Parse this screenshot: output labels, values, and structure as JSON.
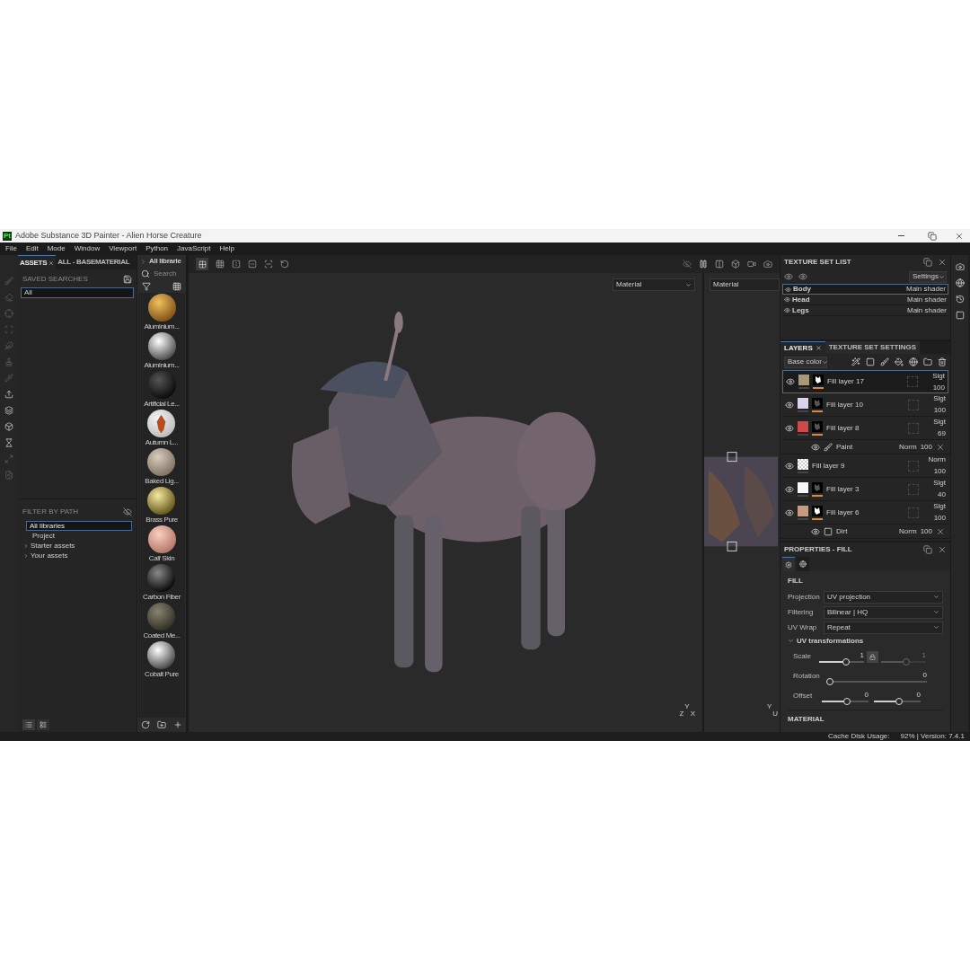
{
  "window": {
    "app_icon": "Pt",
    "title": "Adobe Substance 3D Painter - Alien Horse Creature"
  },
  "menu": [
    "File",
    "Edit",
    "Mode",
    "Window",
    "Viewport",
    "Python",
    "JavaScript",
    "Help"
  ],
  "assets": {
    "tabs": [
      {
        "label": "ASSETS",
        "selected": true
      },
      {
        "label": "ALL - BASEMATERIAL",
        "selected": false
      }
    ],
    "saved_searches": "SAVED SEARCHES",
    "search_value": "All",
    "filter_title": "FILTER BY PATH",
    "paths": [
      {
        "label": "All libraries",
        "selected": true,
        "expandable": false
      },
      {
        "label": "Project",
        "selected": false,
        "expandable": false
      },
      {
        "label": "Starter assets",
        "selected": false,
        "expandable": true
      },
      {
        "label": "Your assets",
        "selected": false,
        "expandable": true
      }
    ],
    "library": "All librarie",
    "search_placeholder": "Search",
    "materials": [
      "Aluminium...",
      "Aluminium...",
      "Artificial Le...",
      "Autumn L...",
      "Baked Lig...",
      "Brass Pure",
      "Calf Skin",
      "Carbon Fiber",
      "Coated Me...",
      "Cobalt Pure"
    ]
  },
  "viewport": {
    "left_mode": "Material",
    "right_mode": "Material",
    "axis_z": "Z",
    "axis_y": "Y",
    "axis_x": "X",
    "uv_y": "Y",
    "uv_u": "U"
  },
  "texture_sets": {
    "title": "TEXTURE SET LIST",
    "settings": "Settings",
    "items": [
      {
        "name": "Body",
        "shader": "Main shader",
        "selected": true
      },
      {
        "name": "Head",
        "shader": "Main shader",
        "selected": false
      },
      {
        "name": "Legs",
        "shader": "Main shader",
        "selected": false
      }
    ]
  },
  "layers": {
    "tabs": [
      {
        "label": "LAYERS",
        "selected": true
      },
      {
        "label": "TEXTURE SET SETTINGS",
        "selected": false
      }
    ],
    "channel": "Base color",
    "items": [
      {
        "kind": "fill",
        "name": "Fill layer 17",
        "blend": "Slgt",
        "opacity": "100",
        "color": "#a89878",
        "selected": true
      },
      {
        "kind": "fill",
        "name": "Fill layer 10",
        "blend": "Slgt",
        "opacity": "100",
        "color": "#ddd4ec",
        "selected": false
      },
      {
        "kind": "fill",
        "name": "Fill layer 8",
        "blend": "Slgt",
        "opacity": "69",
        "color": "#d04848",
        "selected": false
      },
      {
        "kind": "paint",
        "name": "Paint",
        "blend": "Norm",
        "opacity": "100"
      },
      {
        "kind": "transparent",
        "name": "Fill layer 9",
        "blend": "Norm",
        "opacity": "100",
        "selected": false
      },
      {
        "kind": "fill",
        "name": "Fill layer 3",
        "blend": "Slgt",
        "opacity": "40",
        "color": "#f8f8f8",
        "selected": false
      },
      {
        "kind": "fill",
        "name": "Fill layer 6",
        "blend": "Slgt",
        "opacity": "100",
        "color": "#c89a80",
        "selected": false
      },
      {
        "kind": "mask",
        "name": "Dirt",
        "blend": "Norm",
        "opacity": "100"
      }
    ]
  },
  "properties": {
    "title": "PROPERTIES - FILL",
    "section": "FILL",
    "fields": [
      {
        "label": "Projection",
        "value": "UV projection"
      },
      {
        "label": "Filtering",
        "value": "Bilinear | HQ"
      },
      {
        "label": "UV Wrap",
        "value": "Repeat"
      }
    ],
    "group": {
      "label": "UV transformations",
      "expanded": true
    },
    "scale": {
      "label": "Scale",
      "locked": true,
      "sliders": [
        {
          "value": "1",
          "level": 0.62
        },
        {
          "value": "1",
          "level": 0.58
        }
      ]
    },
    "rotation": {
      "label": "Rotation",
      "sliders": [
        {
          "value": "0",
          "level": 0
        }
      ]
    },
    "offset": {
      "label": "Offset",
      "sliders": [
        {
          "value": "0",
          "level": 0.55
        },
        {
          "value": "0",
          "level": 0.55
        }
      ]
    },
    "material": "MATERIAL"
  },
  "status": {
    "cache_label": "Cache Disk Usage:",
    "cache_value": "92% | Version: 7.4.1"
  }
}
